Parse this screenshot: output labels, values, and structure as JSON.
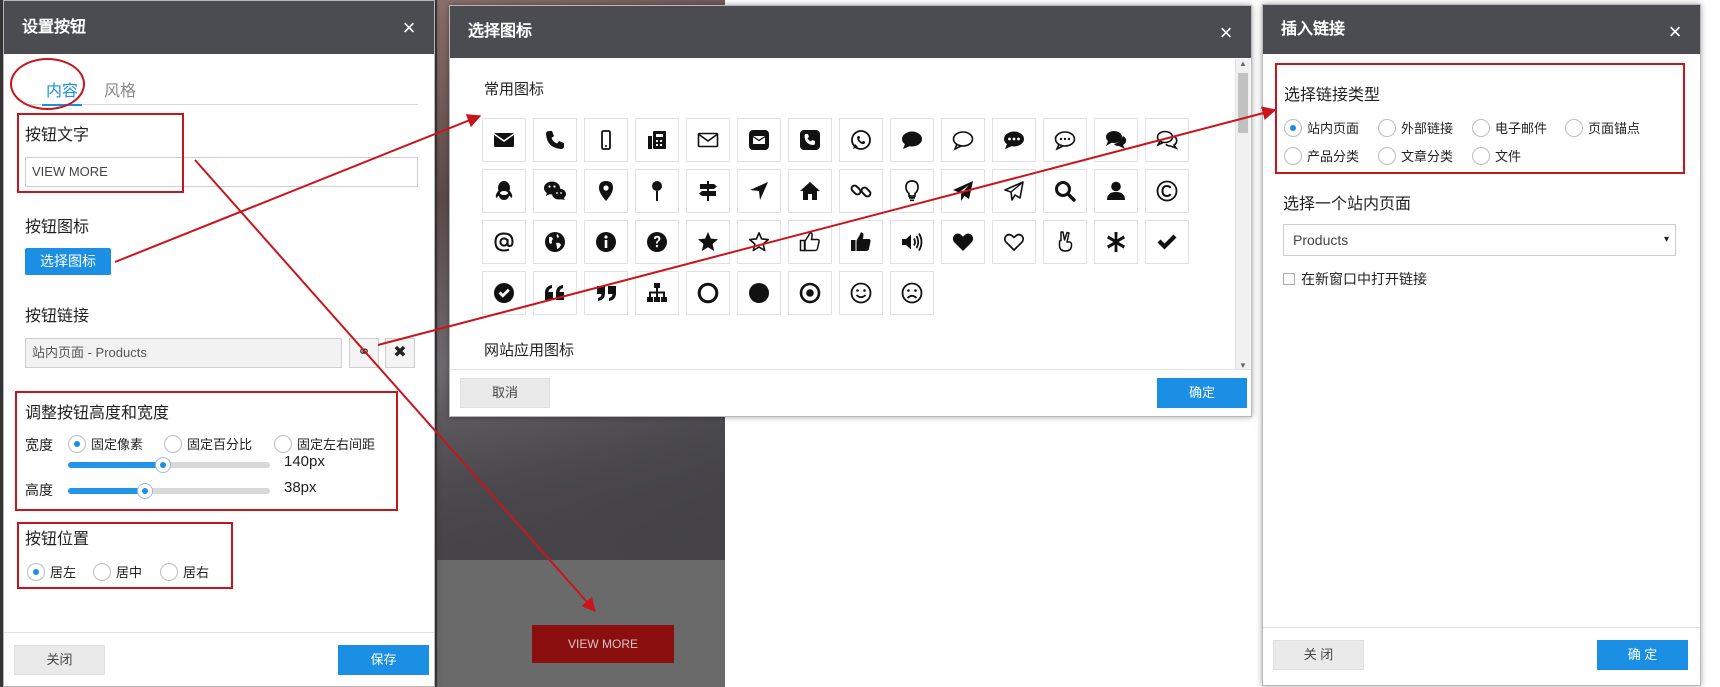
{
  "background": {
    "view_more_label": "VIEW MORE"
  },
  "dialog_button": {
    "title": "设置按钮",
    "close_icon": "×",
    "tabs": [
      {
        "label": "内容"
      },
      {
        "label": "风格"
      }
    ],
    "text_section": {
      "label": "按钮文字",
      "value": "VIEW MORE"
    },
    "icon_section": {
      "label": "按钮图标",
      "button_label": "选择图标"
    },
    "link_section": {
      "label": "按钮链接",
      "value": "站内页面 - Products",
      "link_icon": "⚭",
      "clear_icon": "✖"
    },
    "size_section": {
      "label": "调整按钮高度和宽度",
      "width_label": "宽度",
      "width_options": [
        {
          "label": "固定像素",
          "selected": true
        },
        {
          "label": "固定百分比",
          "selected": false
        },
        {
          "label": "固定左右间距",
          "selected": false
        }
      ],
      "width_value": "140px",
      "width_slider_level": 0.47,
      "height_label": "高度",
      "height_value": "38px",
      "height_slider_level": 0.38
    },
    "position_section": {
      "label": "按钮位置",
      "options": [
        {
          "label": "居左",
          "selected": true
        },
        {
          "label": "居中",
          "selected": false
        },
        {
          "label": "居右",
          "selected": false
        }
      ]
    },
    "close_button": "关闭",
    "save_button": "保存"
  },
  "dialog_icons": {
    "title": "选择图标",
    "close_icon": "×",
    "groups": [
      {
        "title": "常用图标"
      },
      {
        "title": "网站应用图标"
      }
    ],
    "icons": [
      "envelope-icon",
      "phone-icon",
      "mobile-icon",
      "fax-icon",
      "envelope-outline-icon",
      "envelope-square-icon",
      "phone-square-icon",
      "whatsapp-icon",
      "comment-icon",
      "comment-outline-icon",
      "commenting-icon",
      "commenting-outline-icon",
      "comments-icon",
      "comments-outline-icon",
      "qq-icon",
      "wechat-icon",
      "map-marker-icon",
      "map-pin-icon",
      "map-signs-icon",
      "location-arrow-icon",
      "home-icon",
      "chain-icon",
      "lightbulb-icon",
      "paper-plane-icon",
      "paper-plane-outline-icon",
      "search-icon",
      "user-icon",
      "copyright-icon",
      "at-icon",
      "globe-icon",
      "info-circle-icon",
      "question-circle-icon",
      "star-icon",
      "star-outline-icon",
      "thumbs-up-outline-icon",
      "thumbs-up-icon",
      "volume-up-icon",
      "heart-icon",
      "heart-outline-icon",
      "hand-peace-icon",
      "asterisk-icon",
      "check-icon",
      "check-circle-icon",
      "quote-left-icon",
      "quote-right-icon",
      "sitemap-icon",
      "circle-outline-icon",
      "circle-icon",
      "dot-circle-icon",
      "smile-icon",
      "frown-icon"
    ],
    "cancel_button": "取消",
    "ok_button": "确定"
  },
  "dialog_link": {
    "title": "插入链接",
    "close_icon": "×",
    "type_label": "选择链接类型",
    "types": [
      {
        "label": "站内页面",
        "selected": true
      },
      {
        "label": "外部链接",
        "selected": false
      },
      {
        "label": "电子邮件",
        "selected": false
      },
      {
        "label": "页面锚点",
        "selected": false
      },
      {
        "label": "产品分类",
        "selected": false
      },
      {
        "label": "文章分类",
        "selected": false
      },
      {
        "label": "文件",
        "selected": false
      }
    ],
    "page_label": "选择一个站内页面",
    "page_value": "Products",
    "caret": "▾",
    "new_window_label": "在新窗口中打开链接",
    "new_window_checked": false,
    "close_button": "关 闭",
    "ok_button": "确 定"
  },
  "colors": {
    "accent": "#1a8fe3",
    "header": "#4b4c51",
    "annotation_red": "#c8151c",
    "bg_button": "#8b0f0f"
  }
}
